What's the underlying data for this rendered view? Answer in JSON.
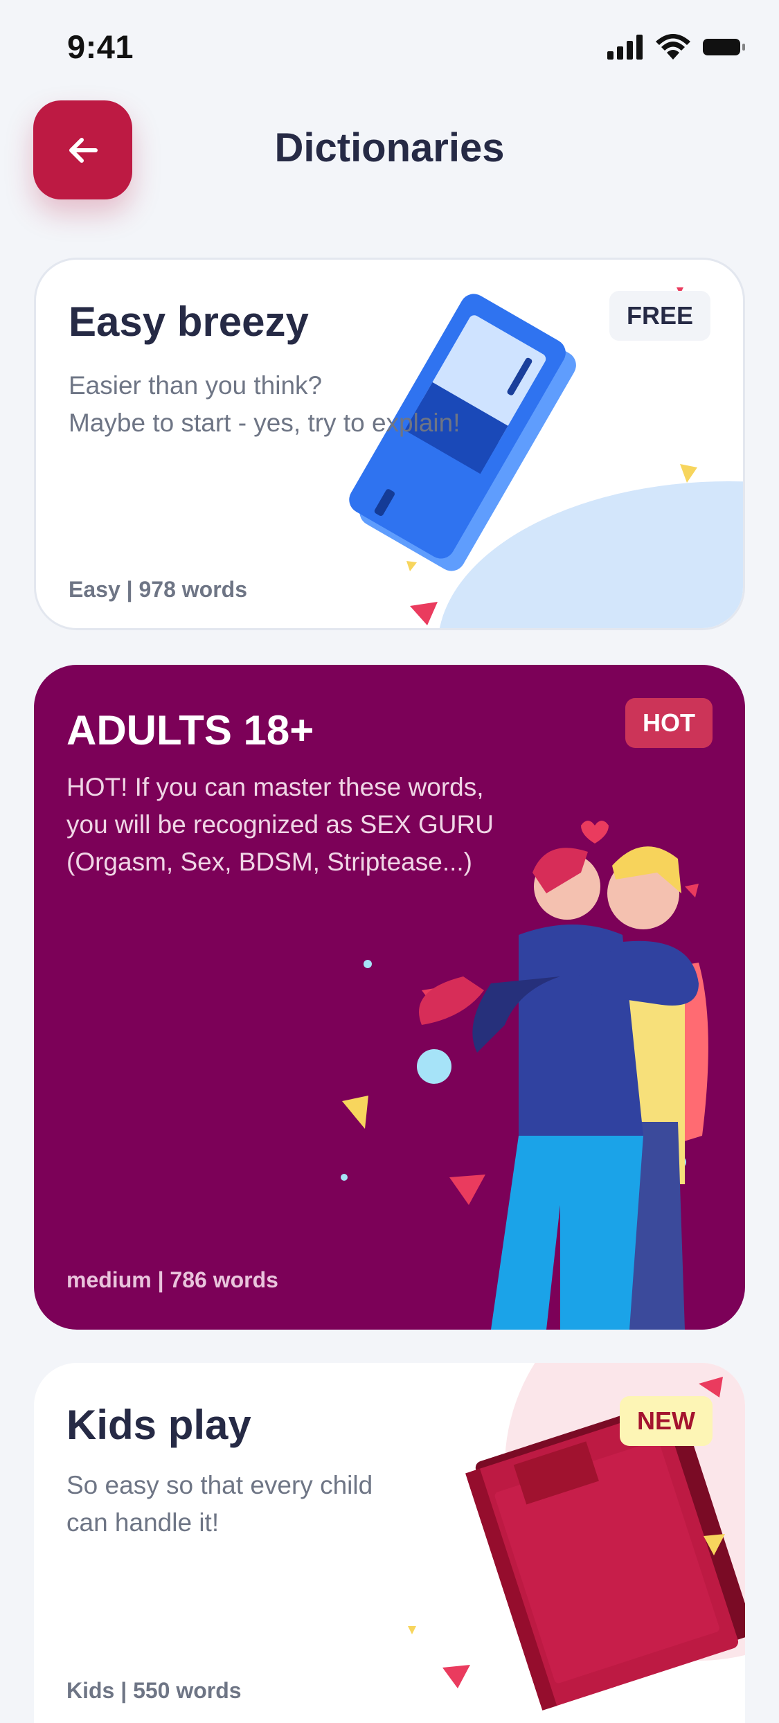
{
  "status_bar": {
    "time": "9:41"
  },
  "header": {
    "title": "Dictionaries",
    "back_icon": "arrow-left-icon"
  },
  "colors": {
    "accent": "#bd1a43",
    "adults_bg": "#7c0158",
    "text_dark": "#262a45",
    "text_muted": "#6e7585"
  },
  "cards": [
    {
      "title": "Easy breezy",
      "description": "Easier than you think?\nMaybe to start - yes, try to explain!",
      "meta": "Easy | 978 words",
      "badge": "FREE"
    },
    {
      "title": "ADULTS 18+",
      "description": "HOT! If you can master these words,\nyou will be recognized as SEX GURU\n(Orgasm, Sex, BDSM, Striptease...)",
      "meta": "medium | 786 words",
      "badge": "HOT"
    },
    {
      "title": "Kids play",
      "description": "So easy so that every child\ncan handle it!",
      "meta": "Kids | 550 words",
      "badge": "NEW"
    }
  ]
}
